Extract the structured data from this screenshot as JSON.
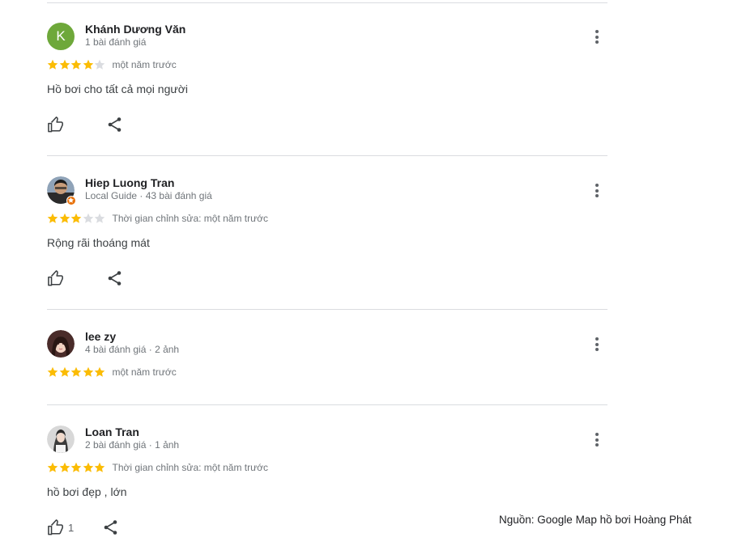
{
  "colors": {
    "star_filled": "#fbbc04",
    "star_empty": "#dadce0",
    "avatar_k": "#6ea83a",
    "local_guide_badge": "#e8710a"
  },
  "icons": {
    "more": "more-vert-icon",
    "like": "thumb-up-icon",
    "share": "share-icon",
    "star": "star-icon"
  },
  "reviews": [
    {
      "name": "Khánh Dương Văn",
      "avatar_letter": "K",
      "meta": "1 bài đánh giá",
      "rating": 4,
      "date": "một năm trước",
      "text": "Hồ bơi cho tất cả mọi người",
      "likes": ""
    },
    {
      "name": "Hiep Luong Tran",
      "avatar_letter": "",
      "meta": "Local Guide · 43 bài đánh giá",
      "rating": 3,
      "date": "Thời gian chỉnh sửa: một năm trước",
      "text": "Rộng rãi thoáng mát",
      "likes": ""
    },
    {
      "name": "lee zy",
      "avatar_letter": "",
      "meta": "4 bài đánh giá · 2 ảnh",
      "rating": 5,
      "date": "một năm trước",
      "text": "",
      "likes": ""
    },
    {
      "name": "Loan Tran",
      "avatar_letter": "",
      "meta": "2 bài đánh giá · 1 ảnh",
      "rating": 5,
      "date": "Thời gian chỉnh sửa: một năm trước",
      "text": "hồ bơi đẹp , lớn",
      "likes": "1"
    }
  ],
  "source_note": "Nguồn: Google Map hồ bơi Hoàng Phát"
}
